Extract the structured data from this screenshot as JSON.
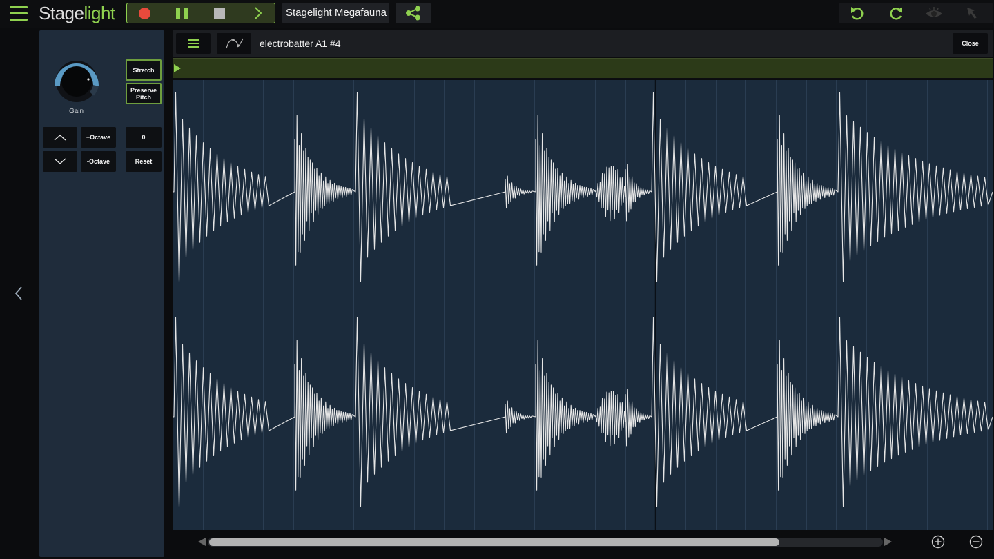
{
  "app": {
    "logo_main": "Stage",
    "logo_accent": "light",
    "project_name": "Stagelight Megafauna"
  },
  "sidepanel": {
    "gain_label": "Gain",
    "stretch_label": "Stretch",
    "preserve_pitch_line1": "Preserve",
    "preserve_pitch_line2": "Pitch",
    "octave_up_label": "+Octave",
    "octave_down_label": "-Octave",
    "octave_value": "0",
    "reset_label": "Reset"
  },
  "editor": {
    "clip_name": "electrobatter A1 #4",
    "close_label": "Close"
  },
  "colors": {
    "accent_green": "#8fd14f",
    "record_red": "#e84a3c",
    "waveform_bg": "#1b2b3c",
    "waveform_line": "#e6e6e6",
    "panel_bg": "#1f2c3b"
  },
  "icons": {
    "menu": "hamburger-icon",
    "record": "record-icon",
    "pause": "pause-icon",
    "stop": "stop-icon",
    "play": "play-chevron-icon",
    "share": "share-icon",
    "undo": "undo-icon",
    "redo": "redo-icon",
    "view": "eye-icon",
    "select": "pointer-icon",
    "back": "chevron-left-icon",
    "clip_menu": "hamburger-icon",
    "automation": "automation-curve-icon",
    "zoom_in": "zoom-in-icon",
    "zoom_out": "zoom-out-icon"
  }
}
